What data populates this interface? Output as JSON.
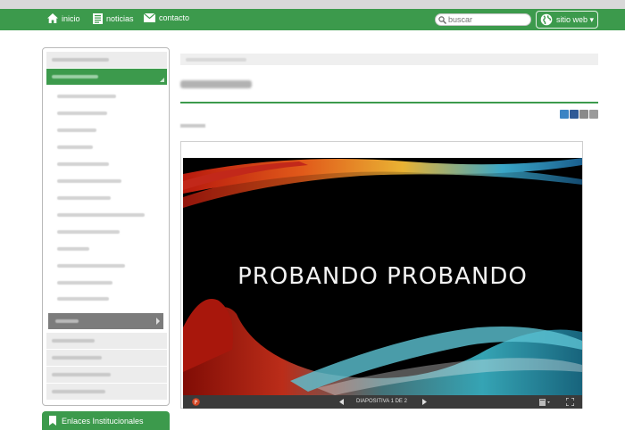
{
  "topbar": {
    "nav": [
      {
        "label": "inicio",
        "icon": "home-icon"
      },
      {
        "label": "noticias",
        "icon": "news-icon"
      },
      {
        "label": "contacto",
        "icon": "mail-icon"
      }
    ],
    "search_placeholder": "buscar",
    "site_label": "sitio web ▾",
    "site_icon": "globe-icon",
    "color": "#3c9a4c"
  },
  "sidebar": {
    "enlaces_label": "Enlaces Institucionales",
    "enlaces_icon": "bookmark-icon"
  },
  "content": {
    "share_icons": [
      "twitter-icon",
      "facebook-icon",
      "email-icon",
      "print-icon"
    ]
  },
  "viewer": {
    "slide_title": "PROBANDO PROBANDO",
    "slide_counter": "DIAPOSITIVA 1 DE 2",
    "app_icon": "powerpoint-icon"
  }
}
